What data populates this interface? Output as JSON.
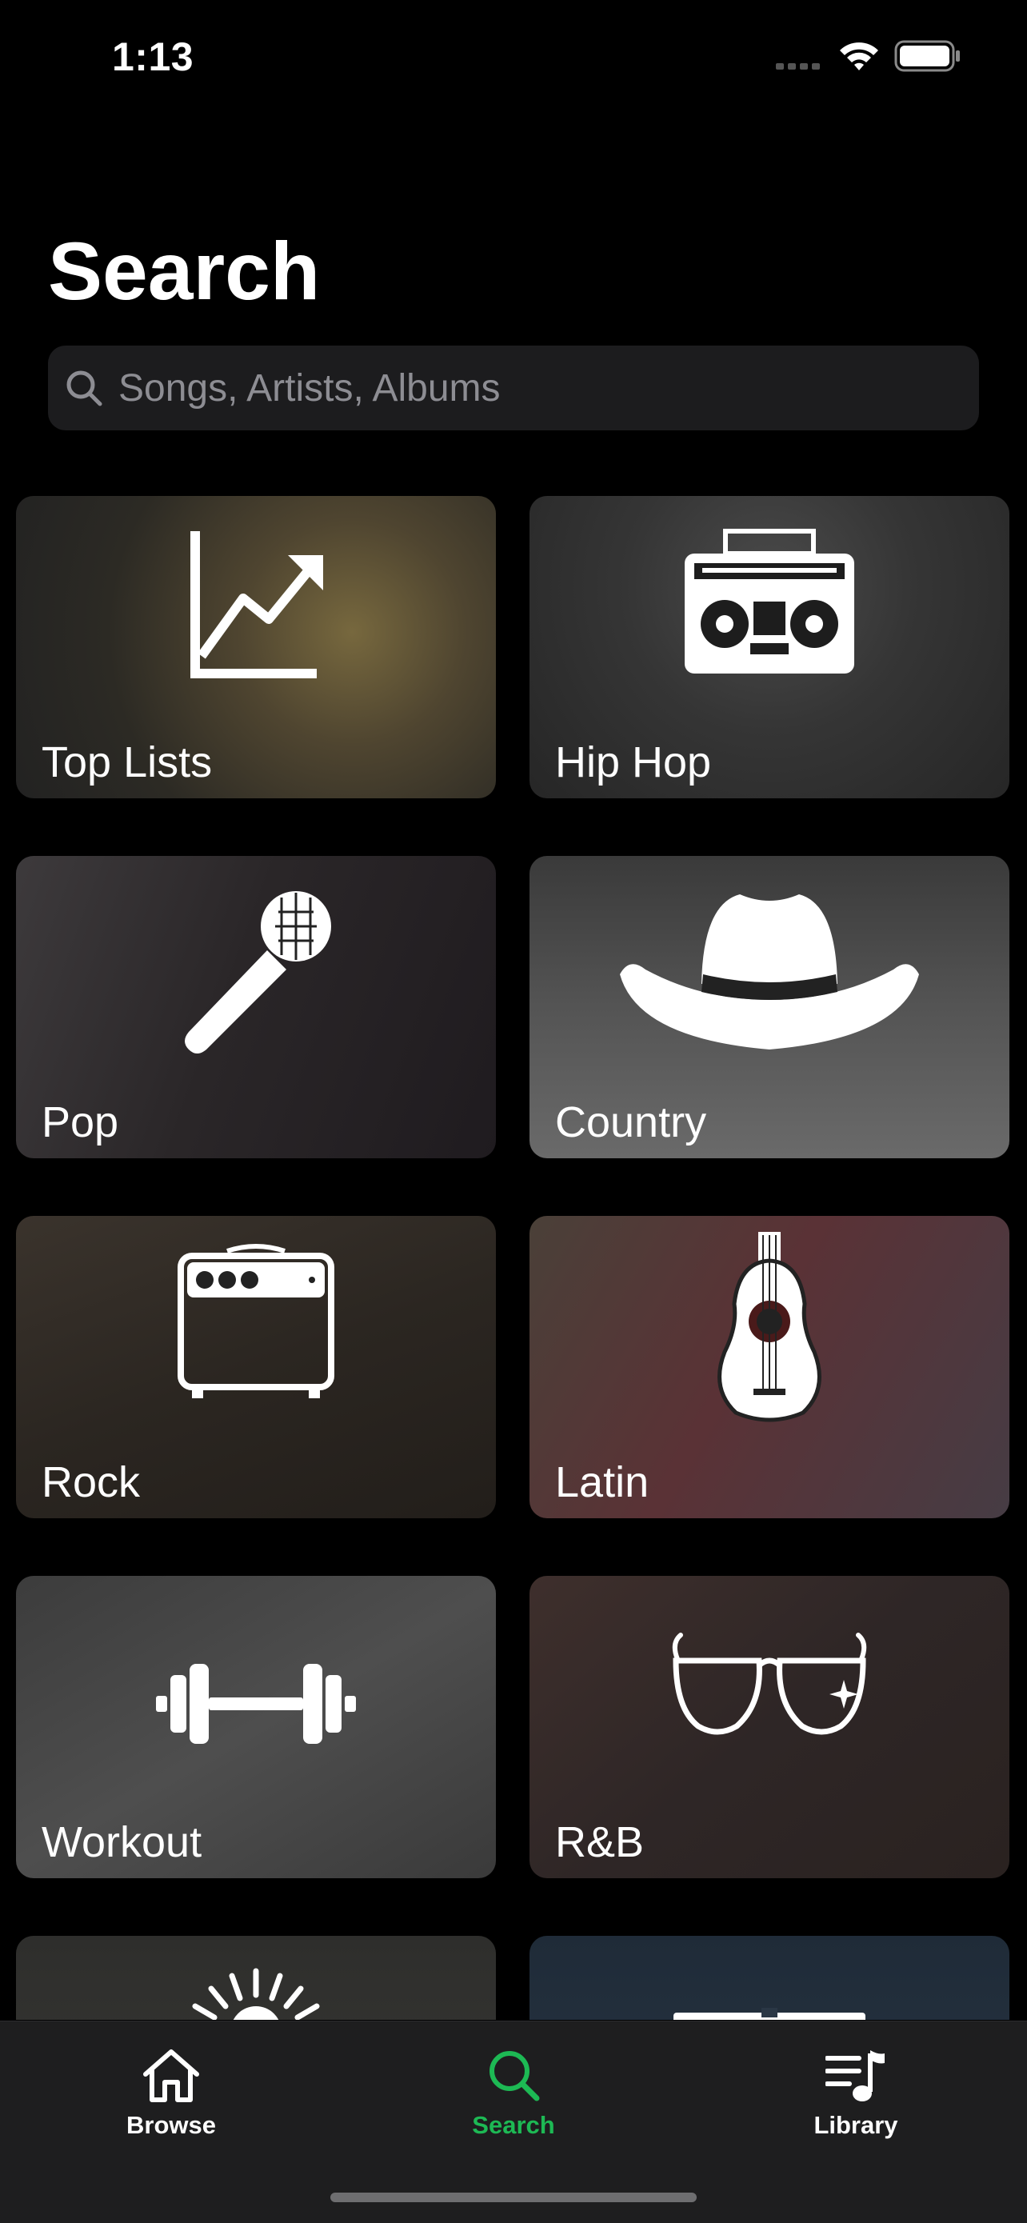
{
  "status_bar": {
    "time": "1:13"
  },
  "page": {
    "title": "Search"
  },
  "search": {
    "placeholder": "Songs, Artists, Albums"
  },
  "categories": [
    {
      "label": "Top Lists",
      "icon": "chart-trend-icon"
    },
    {
      "label": "Hip Hop",
      "icon": "boombox-icon"
    },
    {
      "label": "Pop",
      "icon": "microphone-icon"
    },
    {
      "label": "Country",
      "icon": "cowboy-hat-icon"
    },
    {
      "label": "Rock",
      "icon": "amplifier-icon"
    },
    {
      "label": "Latin",
      "icon": "guitar-icon"
    },
    {
      "label": "Workout",
      "icon": "dumbbell-icon"
    },
    {
      "label": "R&B",
      "icon": "sunglasses-icon"
    }
  ],
  "tab_bar": {
    "tabs": [
      {
        "label": "Browse",
        "icon": "home-icon"
      },
      {
        "label": "Search",
        "icon": "search-icon"
      },
      {
        "label": "Library",
        "icon": "music-library-icon"
      }
    ],
    "active": "Search"
  },
  "colors": {
    "accent": "#1db954",
    "background": "#000000",
    "tab_bar": "#1e1e1f",
    "search_field": "#1c1c1e"
  }
}
